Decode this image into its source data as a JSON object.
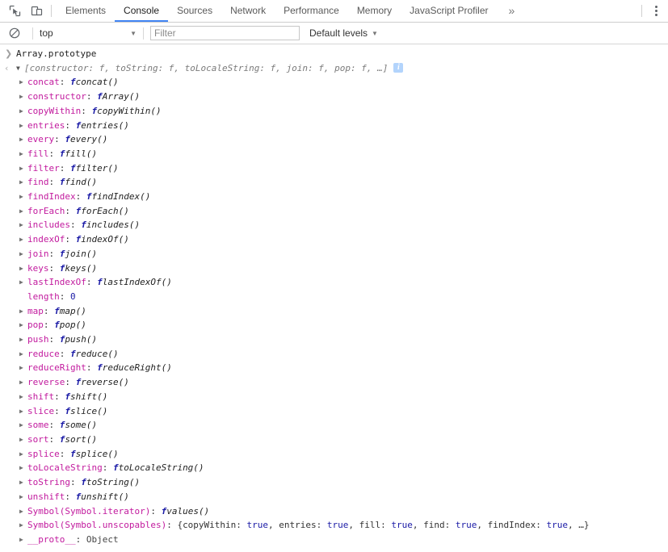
{
  "tabbar": {
    "icons": [
      {
        "name": "inspect-element-icon"
      },
      {
        "name": "toggle-device-toolbar-icon"
      }
    ],
    "tabs": [
      {
        "label": "Elements",
        "active": false
      },
      {
        "label": "Console",
        "active": true
      },
      {
        "label": "Sources",
        "active": false
      },
      {
        "label": "Network",
        "active": false
      },
      {
        "label": "Performance",
        "active": false
      },
      {
        "label": "Memory",
        "active": false
      },
      {
        "label": "JavaScript Profiler",
        "active": false
      }
    ],
    "overflow_label": "»",
    "menu_label": "more-options"
  },
  "filterbar": {
    "clear_label": "clear-console",
    "context": "top",
    "context_caret": "▼",
    "filter_placeholder": "Filter",
    "filter_value": "",
    "levels_label": "Default levels",
    "levels_caret": "▼"
  },
  "console": {
    "input_line": {
      "gutter": "❯",
      "expression": "Array.prototype"
    },
    "result_line": {
      "gutter": "‹",
      "triangle": "▼",
      "preview": "[constructor: f, toString: f, toLocaleString: f, join: f, pop: f, …]",
      "info_badge": "i"
    },
    "properties": [
      {
        "triangle": "▶",
        "name": "concat",
        "sep": ": ",
        "fmark": "f",
        "value": "concat()"
      },
      {
        "triangle": "▶",
        "name": "constructor",
        "sep": ": ",
        "fmark": "f",
        "value": "Array()"
      },
      {
        "triangle": "▶",
        "name": "copyWithin",
        "sep": ": ",
        "fmark": "f",
        "value": "copyWithin()"
      },
      {
        "triangle": "▶",
        "name": "entries",
        "sep": ": ",
        "fmark": "f",
        "value": "entries()"
      },
      {
        "triangle": "▶",
        "name": "every",
        "sep": ": ",
        "fmark": "f",
        "value": "every()"
      },
      {
        "triangle": "▶",
        "name": "fill",
        "sep": ": ",
        "fmark": "f",
        "value": "fill()"
      },
      {
        "triangle": "▶",
        "name": "filter",
        "sep": ": ",
        "fmark": "f",
        "value": "filter()"
      },
      {
        "triangle": "▶",
        "name": "find",
        "sep": ": ",
        "fmark": "f",
        "value": "find()"
      },
      {
        "triangle": "▶",
        "name": "findIndex",
        "sep": ": ",
        "fmark": "f",
        "value": "findIndex()"
      },
      {
        "triangle": "▶",
        "name": "forEach",
        "sep": ": ",
        "fmark": "f",
        "value": "forEach()"
      },
      {
        "triangle": "▶",
        "name": "includes",
        "sep": ": ",
        "fmark": "f",
        "value": "includes()"
      },
      {
        "triangle": "▶",
        "name": "indexOf",
        "sep": ": ",
        "fmark": "f",
        "value": "indexOf()"
      },
      {
        "triangle": "▶",
        "name": "join",
        "sep": ": ",
        "fmark": "f",
        "value": "join()"
      },
      {
        "triangle": "▶",
        "name": "keys",
        "sep": ": ",
        "fmark": "f",
        "value": "keys()"
      },
      {
        "triangle": "▶",
        "name": "lastIndexOf",
        "sep": ": ",
        "fmark": "f",
        "value": "lastIndexOf()"
      },
      {
        "triangle": "",
        "name": "length",
        "sep": ": ",
        "fmark": "",
        "value": "0",
        "kind": "number"
      },
      {
        "triangle": "▶",
        "name": "map",
        "sep": ": ",
        "fmark": "f",
        "value": "map()"
      },
      {
        "triangle": "▶",
        "name": "pop",
        "sep": ": ",
        "fmark": "f",
        "value": "pop()"
      },
      {
        "triangle": "▶",
        "name": "push",
        "sep": ": ",
        "fmark": "f",
        "value": "push()"
      },
      {
        "triangle": "▶",
        "name": "reduce",
        "sep": ": ",
        "fmark": "f",
        "value": "reduce()"
      },
      {
        "triangle": "▶",
        "name": "reduceRight",
        "sep": ": ",
        "fmark": "f",
        "value": "reduceRight()"
      },
      {
        "triangle": "▶",
        "name": "reverse",
        "sep": ": ",
        "fmark": "f",
        "value": "reverse()"
      },
      {
        "triangle": "▶",
        "name": "shift",
        "sep": ": ",
        "fmark": "f",
        "value": "shift()"
      },
      {
        "triangle": "▶",
        "name": "slice",
        "sep": ": ",
        "fmark": "f",
        "value": "slice()"
      },
      {
        "triangle": "▶",
        "name": "some",
        "sep": ": ",
        "fmark": "f",
        "value": "some()"
      },
      {
        "triangle": "▶",
        "name": "sort",
        "sep": ": ",
        "fmark": "f",
        "value": "sort()"
      },
      {
        "triangle": "▶",
        "name": "splice",
        "sep": ": ",
        "fmark": "f",
        "value": "splice()"
      },
      {
        "triangle": "▶",
        "name": "toLocaleString",
        "sep": ": ",
        "fmark": "f",
        "value": "toLocaleString()"
      },
      {
        "triangle": "▶",
        "name": "toString",
        "sep": ": ",
        "fmark": "f",
        "value": "toString()"
      },
      {
        "triangle": "▶",
        "name": "unshift",
        "sep": ": ",
        "fmark": "f",
        "value": "unshift()"
      },
      {
        "triangle": "▶",
        "name": "Symbol(Symbol.iterator)",
        "sep": ": ",
        "fmark": "f",
        "value": "values()"
      }
    ],
    "unscopables_row": {
      "triangle": "▶",
      "name": "Symbol(Symbol.unscopables)",
      "sep": ": ",
      "open": "{",
      "entries": [
        {
          "key": "copyWithin",
          "value": "true"
        },
        {
          "key": "entries",
          "value": "true"
        },
        {
          "key": "fill",
          "value": "true"
        },
        {
          "key": "find",
          "value": "true"
        },
        {
          "key": "findIndex",
          "value": "true"
        }
      ],
      "ellipsis": ", …}"
    },
    "proto_row": {
      "triangle": "▶",
      "name": "__proto__",
      "sep": ": ",
      "value": "Object"
    }
  },
  "colors": {
    "accent": "#4285f4",
    "property": "#c21a9e",
    "function_keyword": "#1a1aa6",
    "number": "#1a1aa6",
    "boolean": "#1a1aa6",
    "preview": "#7a7a7a",
    "info_badge_bg": "#b3d4fc"
  }
}
